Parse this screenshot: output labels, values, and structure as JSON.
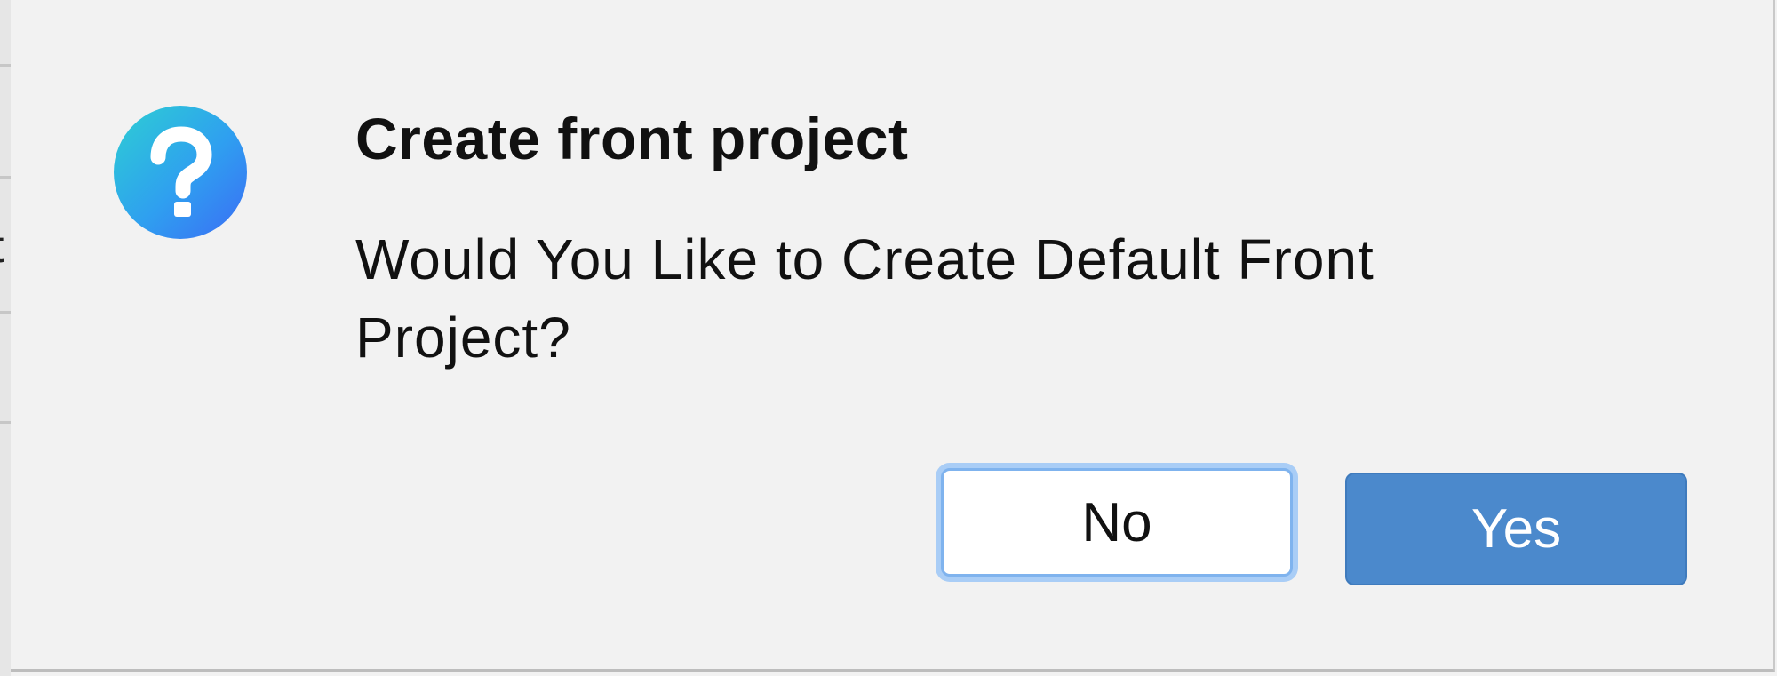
{
  "dialog": {
    "icon": "question-icon",
    "title": "Create front project",
    "message": "Would You Like to Create Default Front Project?",
    "buttons": {
      "no_label": "No",
      "yes_label": "Yes"
    }
  },
  "background": {
    "partial_glyph": "t"
  },
  "colors": {
    "dialog_bg": "#f2f2f2",
    "primary_button": "#4b89cc",
    "focus_ring": "#a9cdf6",
    "icon_gradient_start": "#2dcfd3",
    "icon_gradient_end": "#3b6cf5"
  }
}
